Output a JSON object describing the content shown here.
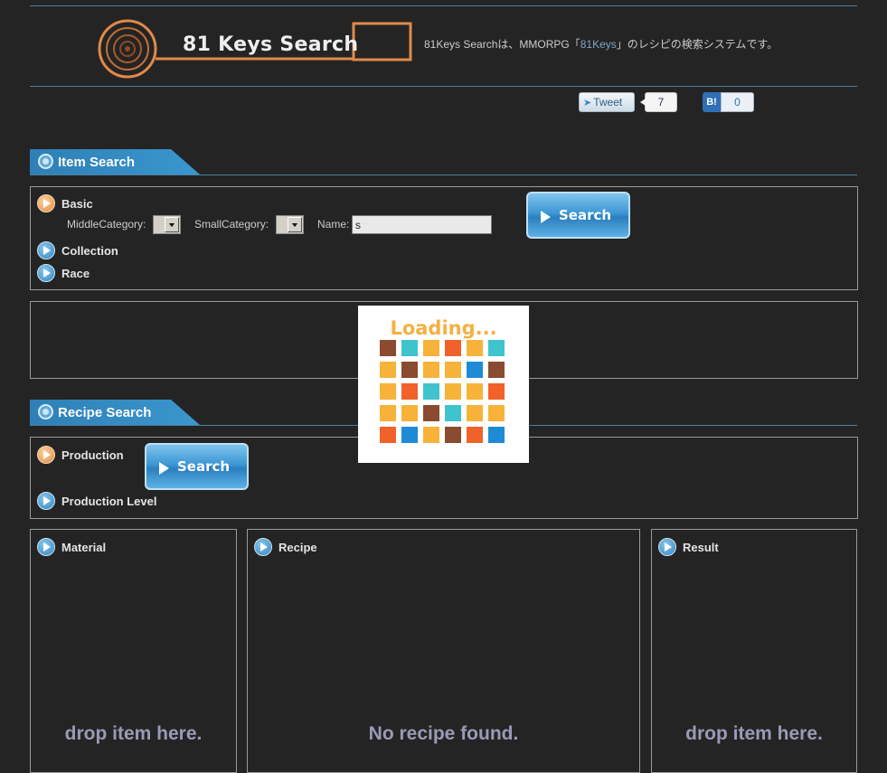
{
  "header": {
    "logo_text": "81 Keys Search",
    "tagline_prefix": "81Keys Searchは、MMORPG「",
    "tagline_link": "81Keys",
    "tagline_suffix": "」のレシピの検索システムです。"
  },
  "social": {
    "tweet_label": "Tweet",
    "tweet_count": "7",
    "hatena_label": "B!",
    "hatena_count": "0"
  },
  "item_search": {
    "title": "Item Search",
    "basic_label": "Basic",
    "middle_category_label": "MiddleCategory:",
    "small_category_label": "SmallCategory:",
    "name_label": "Name:",
    "name_value": "s",
    "collection_label": "Collection",
    "race_label": "Race",
    "search_button": "Search"
  },
  "loading": {
    "title": "Loading...",
    "colors": {
      "brown": "#8a4b30",
      "teal": "#3fc3cc",
      "yellow": "#f7b23a",
      "orange": "#f0622a",
      "blue": "#1f8bd6"
    },
    "grid": [
      [
        "brown",
        "teal",
        "yellow",
        "orange",
        "yellow",
        "teal"
      ],
      [
        "yellow",
        "brown",
        "yellow",
        "yellow",
        "blue",
        "brown"
      ],
      [
        "yellow",
        "orange",
        "teal",
        "yellow",
        "yellow",
        "orange"
      ],
      [
        "yellow",
        "yellow",
        "brown",
        "teal",
        "yellow",
        "yellow"
      ],
      [
        "orange",
        "blue",
        "yellow",
        "brown",
        "orange",
        "blue"
      ]
    ]
  },
  "recipe_search": {
    "title": "Recipe Search",
    "production_label": "Production",
    "production_level_label": "Production Level",
    "search_button": "Search"
  },
  "columns": {
    "material_label": "Material",
    "material_placeholder": "drop item here.",
    "recipe_label": "Recipe",
    "recipe_placeholder": "No recipe found.",
    "result_label": "Result",
    "result_placeholder": "drop item here."
  }
}
